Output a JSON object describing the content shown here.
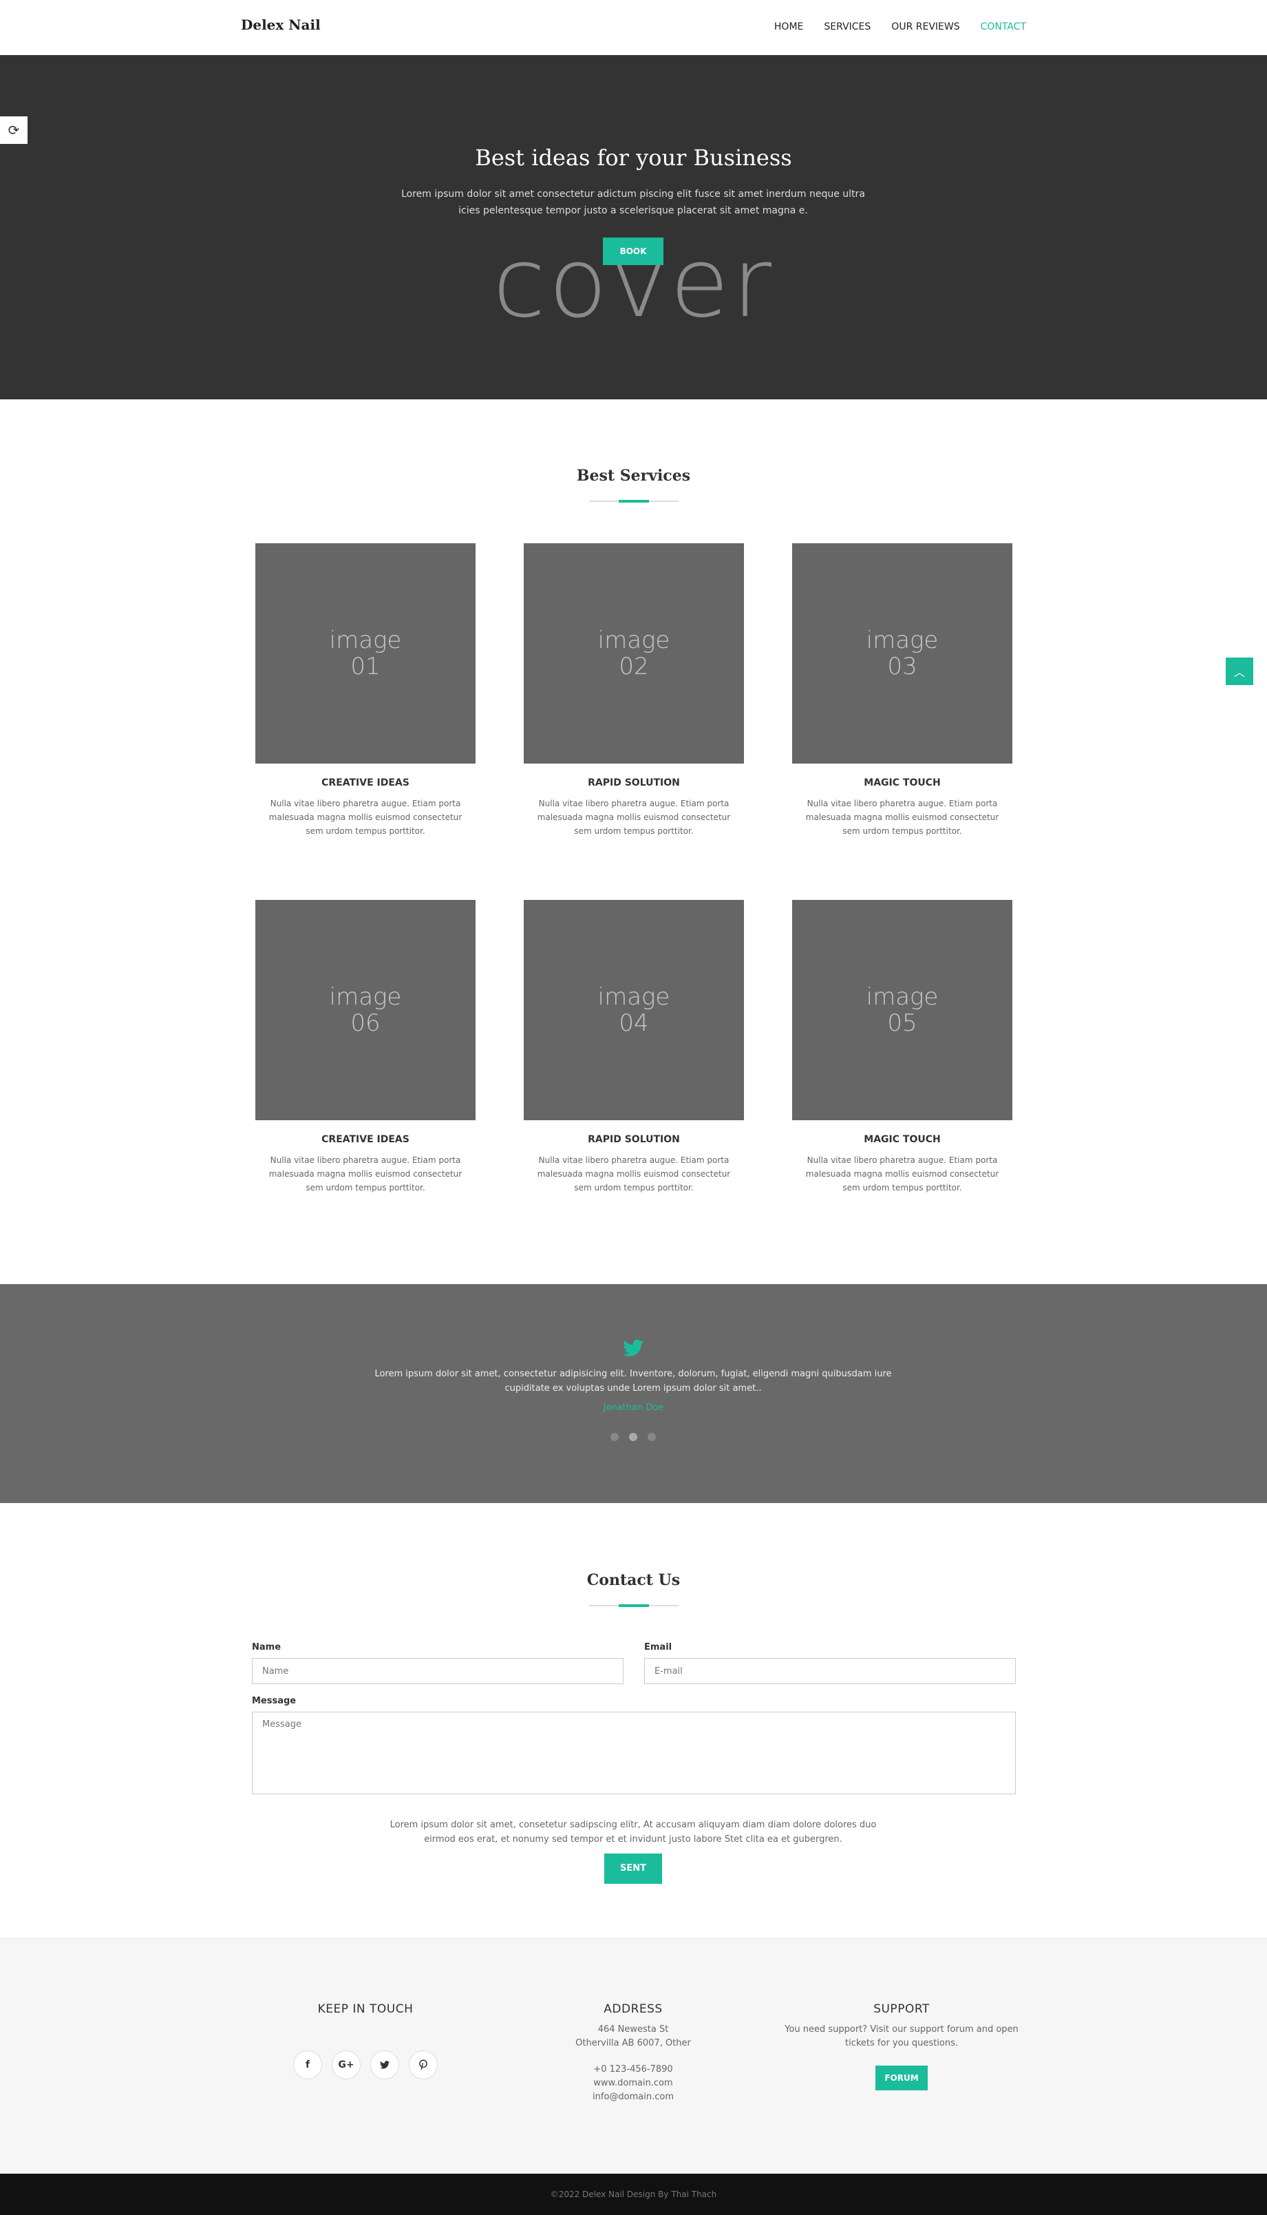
{
  "header": {
    "brand": "Delex Nail",
    "nav": [
      "HOME",
      "SERVICES",
      "OUR REVIEWS",
      "CONTACT"
    ],
    "active_nav": "CONTACT"
  },
  "hero": {
    "title": "Best ideas for your Business",
    "subtitle": "Lorem ipsum dolor sit amet consectetur adictum piscing elit fusce sit amet inerdum neque ultra icies pelentesque tempor justo a scelerisque placerat sit amet magna e.",
    "cover_text": "cover",
    "book_label": "BOOK"
  },
  "services": {
    "title": "Best Services",
    "cards": [
      {
        "img_line1": "image",
        "img_line2": "01",
        "title": "CREATIVE IDEAS",
        "desc": "Nulla vitae libero pharetra augue. Etiam porta malesuada magna mollis euismod consectetur sem urdom tempus porttitor."
      },
      {
        "img_line1": "image",
        "img_line2": "02",
        "title": "RAPID SOLUTION",
        "desc": "Nulla vitae libero pharetra augue. Etiam porta malesuada magna mollis euismod consectetur sem urdom tempus porttitor."
      },
      {
        "img_line1": "image",
        "img_line2": "03",
        "title": "MAGIC TOUCH",
        "desc": "Nulla vitae libero pharetra augue. Etiam porta malesuada magna mollis euismod consectetur sem urdom tempus porttitor."
      },
      {
        "img_line1": "image",
        "img_line2": "06",
        "title": "CREATIVE IDEAS",
        "desc": "Nulla vitae libero pharetra augue. Etiam porta malesuada magna mollis euismod consectetur sem urdom tempus porttitor."
      },
      {
        "img_line1": "image",
        "img_line2": "04",
        "title": "RAPID SOLUTION",
        "desc": "Nulla vitae libero pharetra augue. Etiam porta malesuada magna mollis euismod consectetur sem urdom tempus porttitor."
      },
      {
        "img_line1": "image",
        "img_line2": "05",
        "title": "MAGIC TOUCH",
        "desc": "Nulla vitae libero pharetra augue. Etiam porta malesuada magna mollis euismod consectetur sem urdom tempus porttitor."
      }
    ]
  },
  "testimonial": {
    "icon": "twitter-icon",
    "text": "Lorem ipsum dolor sit amet, consectetur adipisicing elit. Inventore, dolorum, fugiat, eligendi magni quibusdam iure cupiditate ex voluptas unde Lorem ipsum dolor sit amet..",
    "author": "Jonathan Doe",
    "dots": 3,
    "active_dot": 1
  },
  "contact": {
    "title": "Contact Us",
    "name_label": "Name",
    "name_placeholder": "Name",
    "email_label": "Email",
    "email_placeholder": "E-mail",
    "message_label": "Message",
    "message_placeholder": "Message",
    "note": "Lorem ipsum dolor sit amet, consetetur sadipscing elitr, At accusam aliquyam diam diam dolore dolores duo eirmod eos erat, et nonumy sed tempor et et invidunt justo labore Stet clita ea et gubergren.",
    "send_label": "SENT"
  },
  "footer": {
    "keep_title": "KEEP IN TOUCH",
    "socials": [
      "f",
      "G+",
      "t",
      "p"
    ],
    "social_icons": [
      "facebook-icon",
      "google-plus-icon",
      "twitter-icon",
      "pinterest-icon"
    ],
    "address_title": "ADDRESS",
    "address_line1": "464 Newesta St",
    "address_line2": "Othervilla AB 6007, Other",
    "phone": "+0 123-456-7890",
    "web": "www.domain.com",
    "email": "info@domain.com",
    "support_title": "SUPPORT",
    "support_text": "You need support? Visit our support forum and open tickets for you questions.",
    "forum_label": "FORUM"
  },
  "copyright": "©2022 Delex Nail Design By Thai Thach",
  "colors": {
    "accent": "#1bbc9b",
    "hero_bg": "#333333",
    "testimonial_bg": "#696969",
    "footer_bg": "#f6f6f6",
    "bottom_bg": "#111111"
  }
}
